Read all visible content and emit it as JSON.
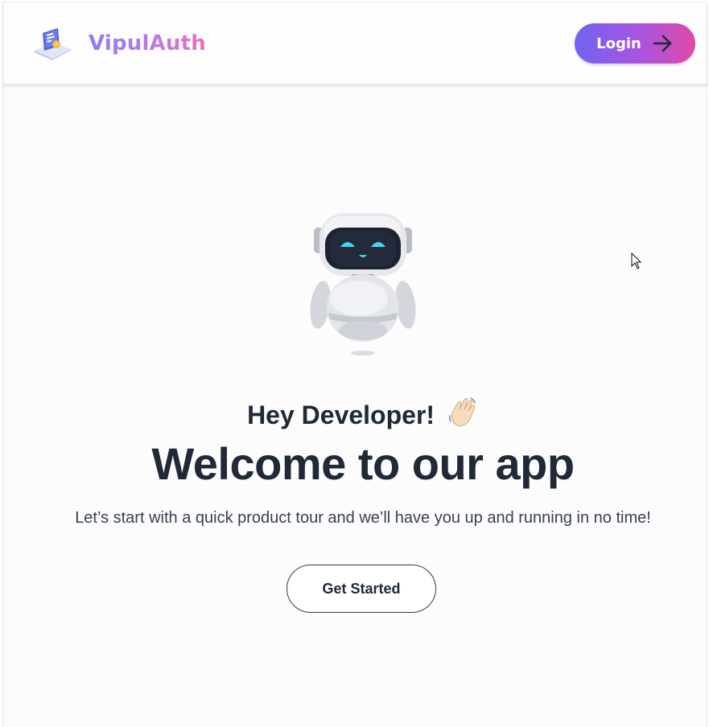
{
  "navbar": {
    "brand_name": "VipulAuth",
    "login_label": "Login"
  },
  "hero": {
    "greeting": "Hey Developer!",
    "headline": "Welcome to our app",
    "subtext": "Let’s start with a quick product tour and we’ll have you up and running in no time!",
    "cta_label": "Get Started"
  },
  "icons": {
    "logo": "security-certificate-icon",
    "login_arrow": "arrow-right-icon",
    "wave": "waving-hand-icon",
    "mascot": "robot-illustration",
    "cursor": "mouse-pointer-icon"
  },
  "colors": {
    "brand_gradient_start": "#8b7cf6",
    "brand_gradient_end": "#ec6fb8",
    "button_gradient_start": "#7064f2",
    "button_gradient_end": "#e04aa8",
    "text_dark": "#1f2937"
  }
}
